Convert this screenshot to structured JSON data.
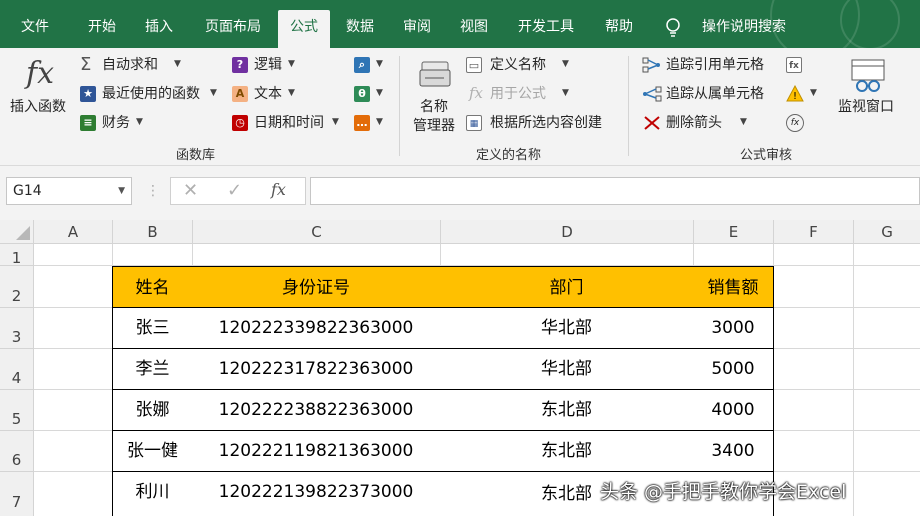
{
  "tabs": [
    "文件",
    "开始",
    "插入",
    "页面布局",
    "公式",
    "数据",
    "审阅",
    "视图",
    "开发工具",
    "帮助"
  ],
  "tell_me": "操作说明搜索",
  "ribbon": {
    "insert_function": {
      "symbol": "fx",
      "label": "插入函数"
    },
    "library": {
      "items": [
        "自动求和",
        "最近使用的函数",
        "财务",
        "逻辑",
        "文本",
        "日期和时间"
      ],
      "group_label": "函数库"
    },
    "names": {
      "name_manager_l1": "名称",
      "name_manager_l2": "管理器",
      "define_name": "定义名称",
      "use_in_formula": "用于公式",
      "create_from_selection": "根据所选内容创建",
      "group_label": "定义的名称"
    },
    "audit": {
      "trace_precedents": "追踪引用单元格",
      "trace_dependents": "追踪从属单元格",
      "remove_arrows": "删除箭头",
      "group_label": "公式审核"
    },
    "watch_window": "监视窗口"
  },
  "formula_bar": {
    "name_box": "G14",
    "fx": "fx",
    "formula": ""
  },
  "columns": [
    "A",
    "B",
    "C",
    "D",
    "E",
    "F",
    "G"
  ],
  "rows": [
    "1",
    "2",
    "3",
    "4",
    "5",
    "6",
    "7"
  ],
  "table": {
    "headers": [
      "姓名",
      "身份证号",
      "部门",
      "销售额"
    ],
    "rows": [
      [
        "张三",
        "120222339822363000",
        "华北部",
        "3000"
      ],
      [
        "李兰",
        "120222317822363000",
        "华北部",
        "5000"
      ],
      [
        "张娜",
        "120222238822363000",
        "东北部",
        "4000"
      ],
      [
        "张一健",
        "120222119821363000",
        "东北部",
        "3400"
      ],
      [
        "利川",
        "120222139822373000",
        "东北部",
        ""
      ]
    ]
  },
  "watermark": "头条 @手把手教你学会Excel",
  "colors": {
    "excel_green": "#217346",
    "header_fill": "#ffc000"
  }
}
